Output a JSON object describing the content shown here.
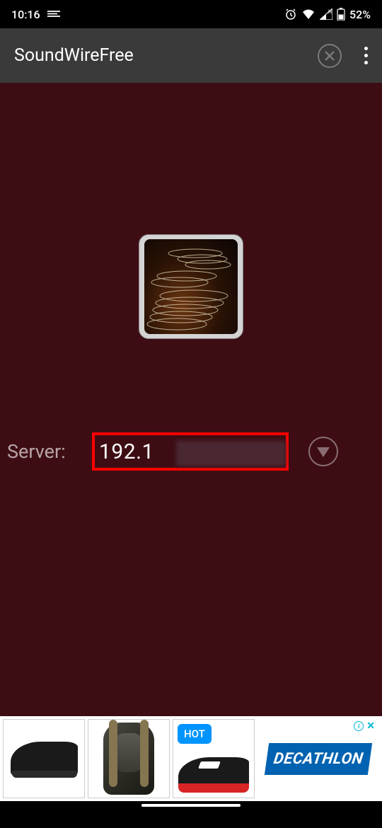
{
  "status": {
    "time": "10:16",
    "battery": "52%"
  },
  "app": {
    "title": "SoundWireFree"
  },
  "server": {
    "label": "Server:",
    "value": "192.1"
  },
  "ad": {
    "badge": "HOT",
    "brand": "DECATHLON"
  }
}
